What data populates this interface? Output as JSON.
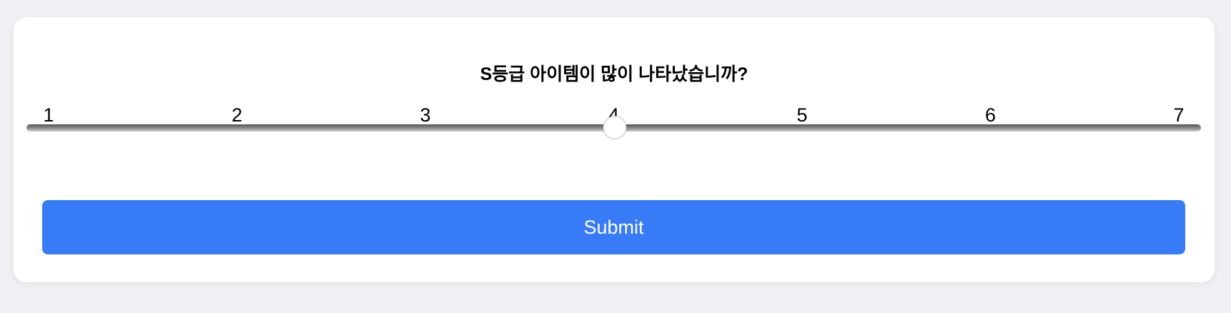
{
  "question": "S등급 아이템이 많이 나타났습니까?",
  "scale": {
    "labels": [
      "1",
      "2",
      "3",
      "4",
      "5",
      "6",
      "7"
    ],
    "min": 1,
    "max": 7,
    "value": 4
  },
  "submit_label": "Submit",
  "colors": {
    "accent": "#377bf6"
  }
}
